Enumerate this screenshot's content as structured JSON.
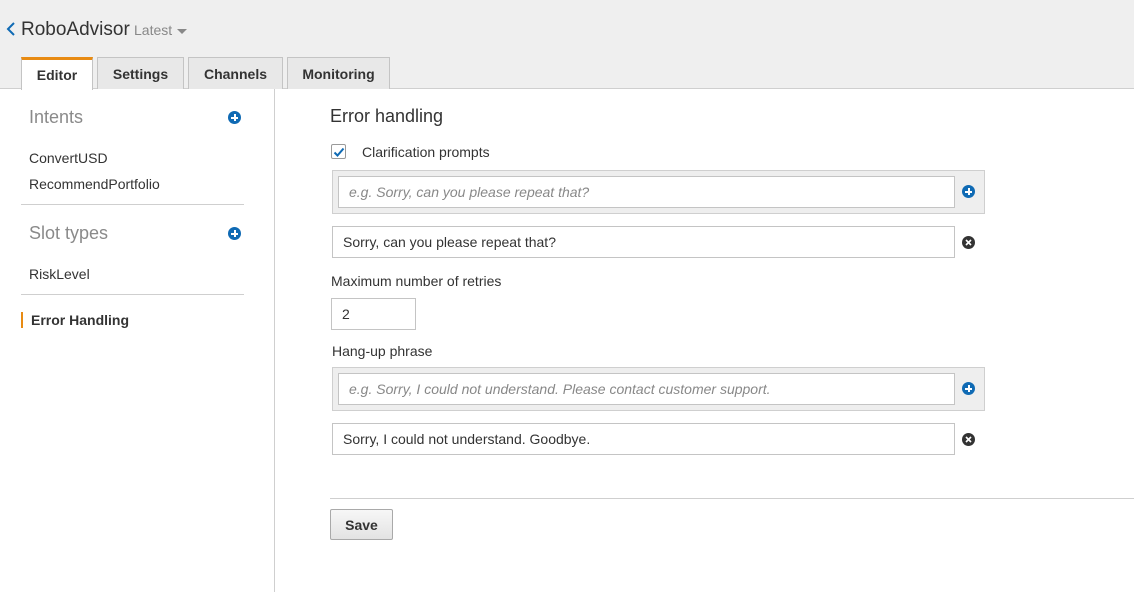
{
  "header": {
    "bot_name": "RoboAdvisor",
    "version": "Latest",
    "tabs": [
      {
        "label": "Editor",
        "active": true
      },
      {
        "label": "Settings",
        "active": false
      },
      {
        "label": "Channels",
        "active": false
      },
      {
        "label": "Monitoring",
        "active": false
      }
    ]
  },
  "sidebar": {
    "intents_title": "Intents",
    "intents": [
      "ConvertUSD",
      "RecommendPortfolio"
    ],
    "slot_types_title": "Slot types",
    "slot_types": [
      "RiskLevel"
    ],
    "error_handling": "Error Handling"
  },
  "main": {
    "title": "Error handling",
    "clarification": {
      "label": "Clarification prompts",
      "checked": true,
      "placeholder": "e.g. Sorry, can you please repeat that?",
      "value": "Sorry, can you please repeat that?"
    },
    "retries": {
      "label": "Maximum number of retries",
      "value": "2"
    },
    "hangup": {
      "label": "Hang-up phrase",
      "placeholder": "e.g. Sorry, I could not understand. Please contact customer support.",
      "value": "Sorry, I could not understand. Goodbye."
    },
    "save_label": "Save"
  },
  "icons": {
    "back": "chevron-left-icon",
    "version_caret": "caret-down-icon",
    "add": "plus-circle-icon",
    "remove": "x-circle-icon",
    "check": "checkmark-icon"
  },
  "colors": {
    "accent": "#e88b13",
    "link_blue": "#0f6ab4"
  }
}
